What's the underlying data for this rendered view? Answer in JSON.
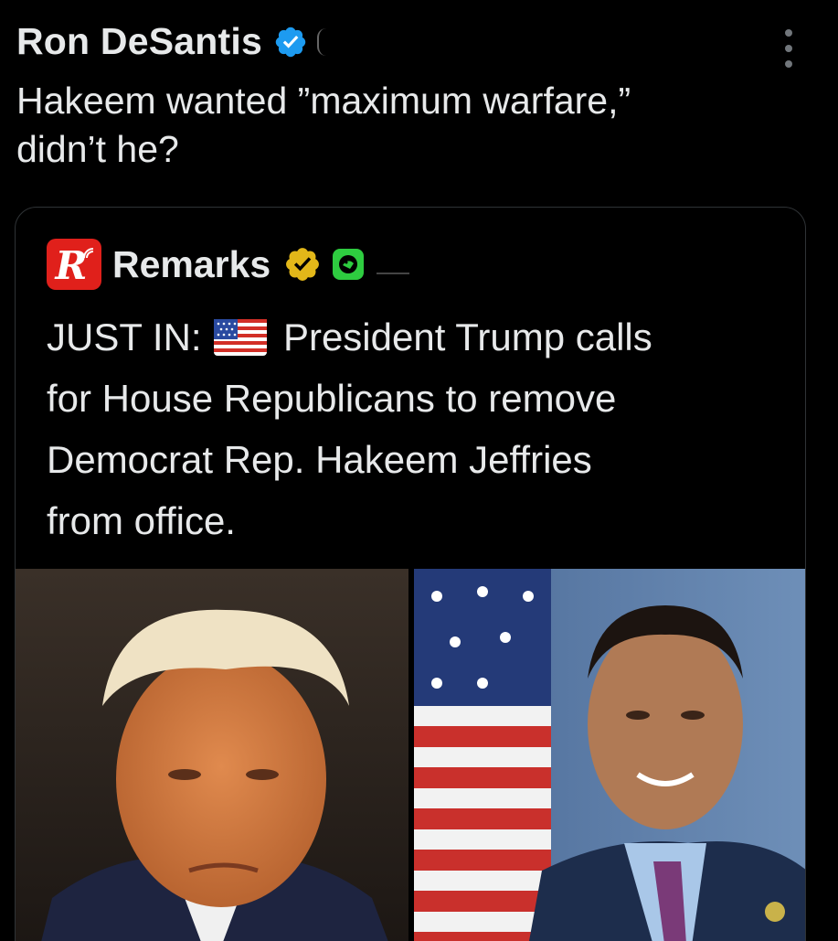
{
  "tweet": {
    "author_name": "Ron DeSantis",
    "verified": true,
    "text_lines": [
      "Hakeem wanted ”maximum warfare,”",
      "didn’t he?"
    ]
  },
  "quoted_tweet": {
    "author_name": "Remarks",
    "avatar_letter": "R",
    "verified_badge": "gold-checkmark",
    "affiliation_badge": "green-affiliate",
    "text_line1_prefix": "JUST IN:",
    "text_line1_suffix": "President Trump calls",
    "text_lines_rest": [
      "for House Republicans to remove",
      "Democrat Rep. Hakeem Jeffries",
      "from office."
    ],
    "media": [
      {
        "name": "left-photo",
        "subject": "portrait"
      },
      {
        "name": "right-photo",
        "subject": "portrait"
      }
    ]
  },
  "colors": {
    "background": "#000000",
    "text": "#e7e9ea",
    "verified_blue": "#1d9bf0",
    "gold": "#e2b719",
    "remarks_red": "#e0201b",
    "card_border": "#2f3336"
  }
}
